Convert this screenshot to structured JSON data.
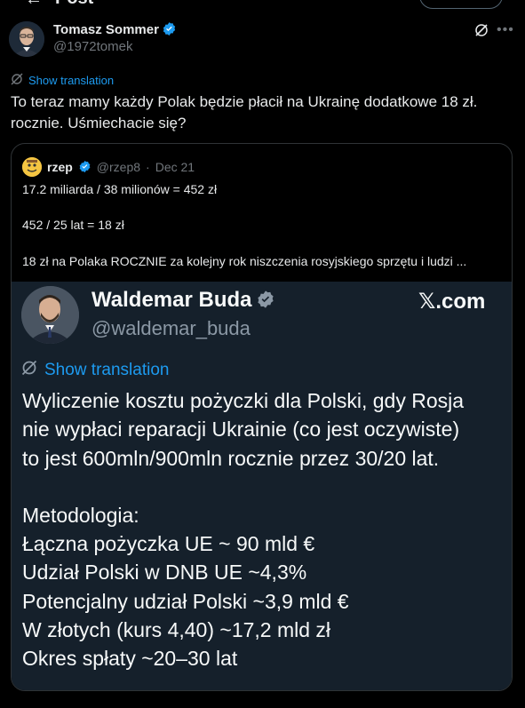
{
  "page": {
    "header_title": "Post",
    "back_icon": "arrow-left-icon"
  },
  "tweet": {
    "author_name": "Tomasz Sommer",
    "author_handle": "@1972tomek",
    "verified_color": "#1d9bf0",
    "show_translation": "Show translation",
    "text_line1": "To teraz mamy każdy Polak będzie płacił na Ukrainę dodatkowe 18 zł.",
    "text_line2": "rocznie. Uśmiechacie się?"
  },
  "quote": {
    "author_name": "rzep",
    "author_handle": "@rzep8",
    "separator": "·",
    "date": "Dec 21",
    "line1": "17.2 miliarda / 38 milionów = 452 zł",
    "line2": "452 / 25 lat = 18 zł",
    "line3": "18 zł na Polaka ROCZNIE za kolejny rok niszczenia rosyjskiego sprzętu i ludzi ..."
  },
  "media": {
    "author_name": "Waldemar Buda",
    "author_handle": "@waldemar_buda",
    "brand": "𝕏.com",
    "show_translation": "Show translation",
    "lines": [
      "Wyliczenie kosztu pożyczki dla Polski, gdy Rosja",
      "nie wypłaci reparacji Ukrainie (co jest oczywiste)",
      "to jest 600mln/900mln rocznie przez 30/20 lat."
    ],
    "methodology_title": "Metodologia:",
    "methodology_items": [
      "Łączna pożyczka UE ~ 90 mld €",
      "Udział Polski w DNB UE ~4,3%",
      "Potencjalny udział Polski ~3,9 mld €",
      "W złotych (kurs 4,40) ~17,2 mld zł",
      "Okres spłaty ~20–30 lat"
    ]
  },
  "colors": {
    "background": "#000000",
    "text": "#e7e9ea",
    "muted": "#71767b",
    "accent": "#1d9bf0",
    "media_bg": "#15202b"
  }
}
